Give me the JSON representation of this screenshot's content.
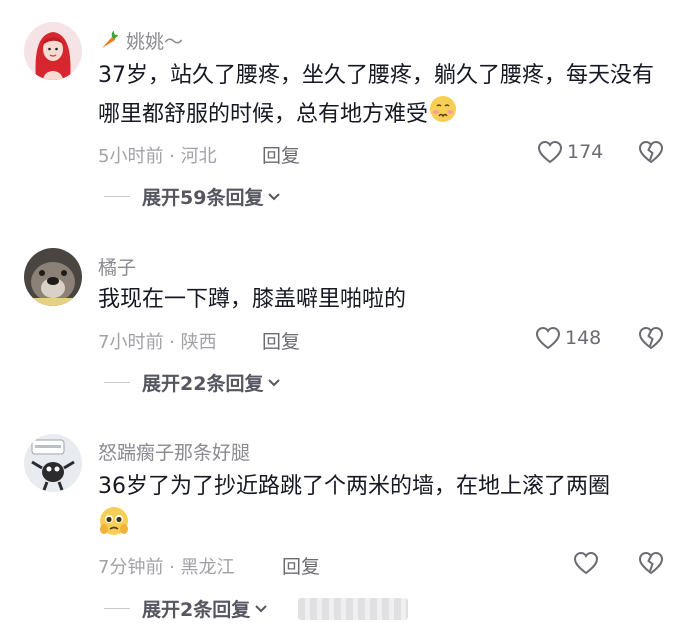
{
  "comments": [
    {
      "username": "姚姚～",
      "text": "37岁，站久了腰疼，坐久了腰疼，躺久了腰疼，每天没有哪里都舒服的时候，总有地方难受",
      "time_location": "5小时前 · 河北",
      "reply_label": "回复",
      "likes": "174",
      "expand_label": "展开59条回复",
      "avatar_icon": "girl-avatar",
      "username_prefix_icon": "carrot-icon"
    },
    {
      "username": "橘子",
      "text": "我现在一下蹲，膝盖噼里啪啦的",
      "time_location": "7小时前 · 陕西",
      "reply_label": "回复",
      "likes": "148",
      "expand_label": "展开22条回复",
      "avatar_icon": "dog-avatar"
    },
    {
      "username": "怒踹瘸子那条好腿",
      "text": "36岁了为了抄近路跳了个两米的墙，在地上滚了两圈",
      "time_location": "7分钟前 · 黑龙江",
      "reply_label": "回复",
      "likes": "",
      "expand_label": "展开2条回复",
      "avatar_icon": "cartoon-avatar"
    }
  ],
  "icons": {
    "like": "heart-outline-icon",
    "dislike": "broken-heart-icon",
    "expand": "chevron-down-icon"
  },
  "colors": {
    "text": "#161823",
    "muted": "#a1a2a7",
    "username": "#8a8b91"
  }
}
